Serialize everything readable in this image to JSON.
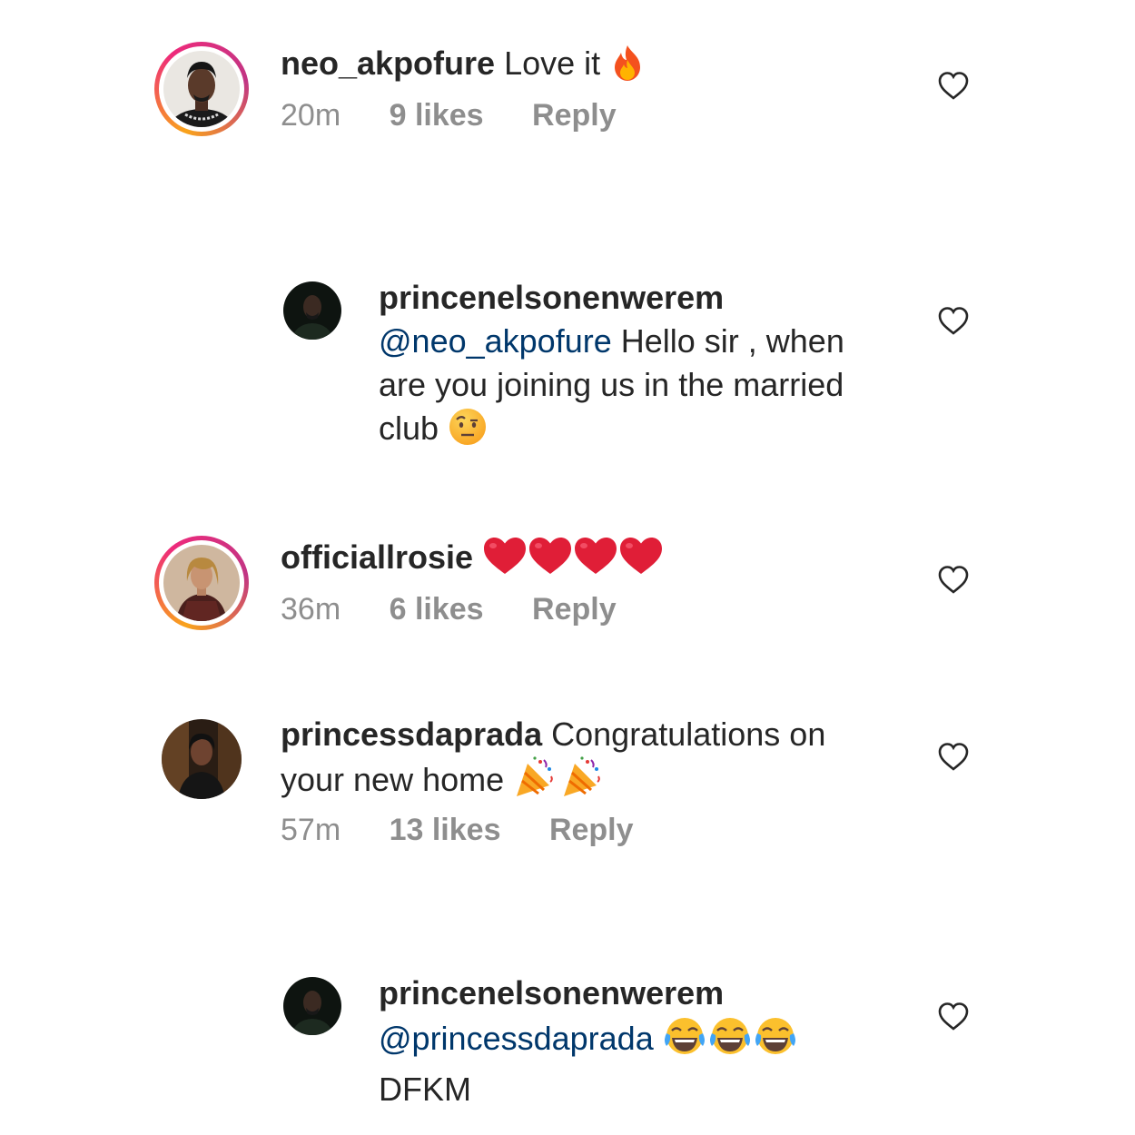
{
  "comments": [
    {
      "username": "neo_akpofure",
      "text": "Love it",
      "emoji": "fire-icon",
      "time": "20m",
      "likes": "9 likes",
      "reply": "Reply"
    },
    {
      "username": "princenelsonenwerem",
      "mention": "@neo_akpofure",
      "text_line1": "Hello sir , when",
      "text_line2": "are you joining us in the married",
      "text_line3": "club",
      "emoji": "raised-eyebrow-face-icon"
    },
    {
      "username": "officiallrosie",
      "emoji": "red-heart-icon",
      "time": "36m",
      "likes": "6 likes",
      "reply": "Reply"
    },
    {
      "username": "princessdaprada",
      "text_line1": "Congratulations on",
      "text_line2": "your new home",
      "emoji": "party-popper-icon",
      "time": "57m",
      "likes": "13 likes",
      "reply": "Reply"
    },
    {
      "username": "princenelsonenwerem",
      "mention": "@princessdaprada",
      "text_line2": "DFKM",
      "emoji": "tears-of-joy-icon"
    }
  ],
  "colors": {
    "username": "#262626",
    "mention": "#00376b",
    "meta": "#8e8e8e",
    "ring_start": "#f9a31b",
    "ring_end": "#c13584"
  }
}
